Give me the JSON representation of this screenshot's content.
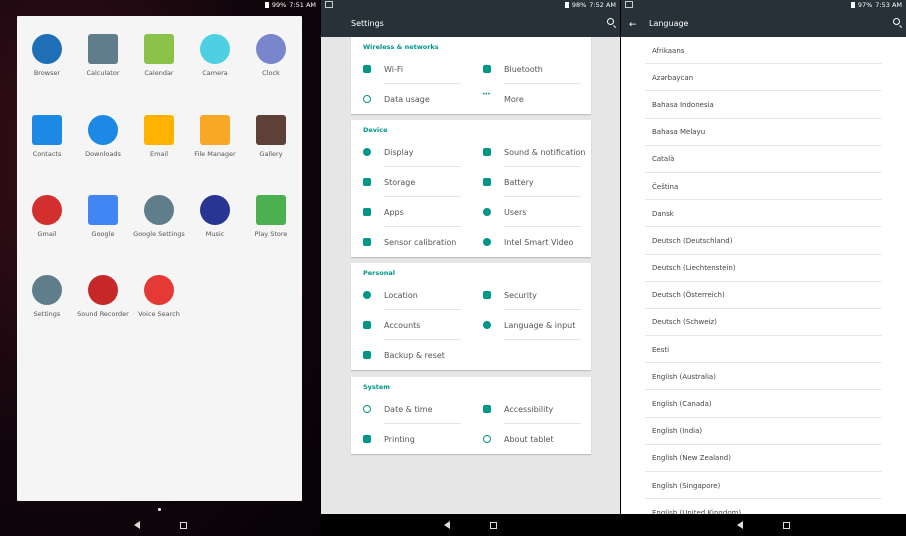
{
  "launcher": {
    "status": {
      "battery": "99%",
      "time": "7:51 AM"
    },
    "apps": [
      {
        "label": "Browser",
        "icon": "globe-icon",
        "color": "#1e6fb5"
      },
      {
        "label": "Calculator",
        "icon": "calculator-icon",
        "color": "#607d8b"
      },
      {
        "label": "Calendar",
        "icon": "calendar-icon",
        "color": "#8bc34a"
      },
      {
        "label": "Camera",
        "icon": "camera-icon",
        "color": "#4dd0e1"
      },
      {
        "label": "Clock",
        "icon": "clock-icon",
        "color": "#7986cb"
      },
      {
        "label": "Contacts",
        "icon": "contacts-icon",
        "color": "#1e88e5"
      },
      {
        "label": "Downloads",
        "icon": "download-icon",
        "color": "#1e88e5"
      },
      {
        "label": "Email",
        "icon": "email-icon",
        "color": "#ffb300"
      },
      {
        "label": "File Manager",
        "icon": "folder-icon",
        "color": "#f9a825"
      },
      {
        "label": "Gallery",
        "icon": "gallery-icon",
        "color": "#5d4037"
      },
      {
        "label": "Gmail",
        "icon": "gmail-icon",
        "color": "#d32f2f"
      },
      {
        "label": "Google",
        "icon": "google-icon",
        "color": "#4285f4"
      },
      {
        "label": "Google Settings",
        "icon": "gear-icon",
        "color": "#607d8b"
      },
      {
        "label": "Music",
        "icon": "music-icon",
        "color": "#283593"
      },
      {
        "label": "Play Store",
        "icon": "play-store-icon",
        "color": "#4caf50"
      },
      {
        "label": "Settings",
        "icon": "settings-icon",
        "color": "#607d8b"
      },
      {
        "label": "Sound Recorder",
        "icon": "microphone-icon",
        "color": "#c62828"
      },
      {
        "label": "Voice Search",
        "icon": "microphone-icon",
        "color": "#e53935"
      }
    ]
  },
  "settings": {
    "status": {
      "battery": "98%",
      "time": "7:52 AM"
    },
    "title": "Settings",
    "sections": [
      {
        "header": "Wireless & networks",
        "items": [
          "Wi-Fi",
          "Bluetooth",
          "Data usage",
          "More"
        ]
      },
      {
        "header": "Device",
        "items": [
          "Display",
          "Sound & notification",
          "Storage",
          "Battery",
          "Apps",
          "Users",
          "Sensor calibration",
          "Intel Smart Video"
        ]
      },
      {
        "header": "Personal",
        "items": [
          "Location",
          "Security",
          "Accounts",
          "Language & input",
          "Backup & reset"
        ]
      },
      {
        "header": "System",
        "items": [
          "Date & time",
          "Accessibility",
          "Printing",
          "About tablet"
        ]
      }
    ],
    "accent": "#009688"
  },
  "language": {
    "status": {
      "battery": "97%",
      "time": "7:53 AM"
    },
    "title": "Language",
    "items": [
      "Afrikaans",
      "Azərbaycan",
      "Bahasa Indonesia",
      "Bahasa Melayu",
      "Català",
      "Čeština",
      "Dansk",
      "Deutsch (Deutschland)",
      "Deutsch (Liechtenstein)",
      "Deutsch (Österreich)",
      "Deutsch (Schweiz)",
      "Eesti",
      "English (Australia)",
      "English (Canada)",
      "English (India)",
      "English (New Zealand)",
      "English (Singapore)",
      "English (United Kingdom)"
    ]
  }
}
